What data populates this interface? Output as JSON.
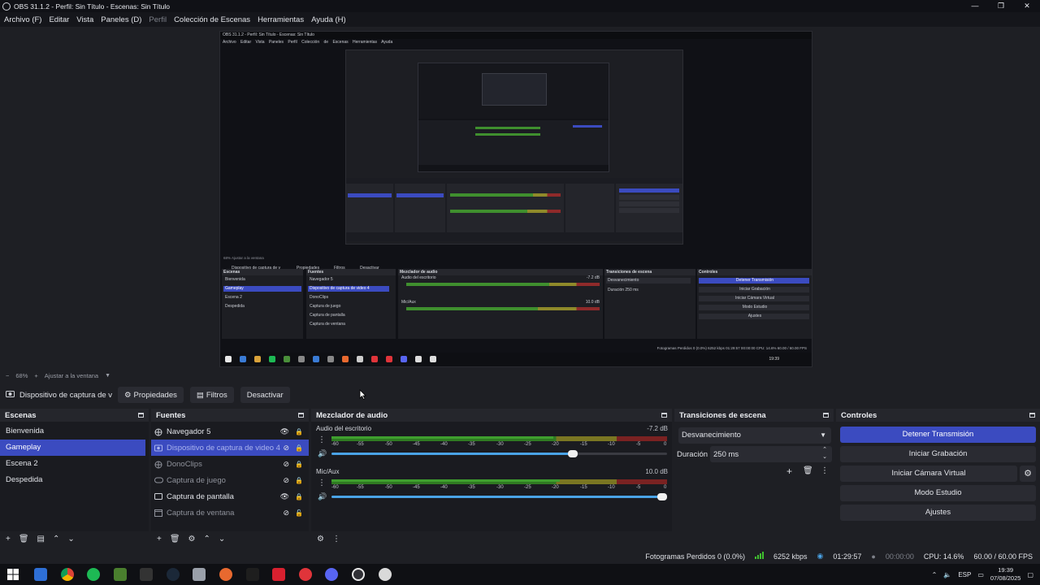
{
  "window": {
    "title": "OBS 31.1.2 - Perfil: Sin Título - Escenas: Sin Título",
    "min": "—",
    "max": "❐",
    "close": "✕"
  },
  "menu": {
    "archivo": "Archivo (F)",
    "editar": "Editar",
    "vista": "Vista",
    "paneles": "Paneles (D)",
    "perfil": "Perfil",
    "coleccion": "Colección de Escenas",
    "herramientas": "Herramientas",
    "ayuda": "Ayuda (H)"
  },
  "nested": {
    "title": "OBS 31.1.2 - Perfil: Sin Título - Escenas: Sin Título",
    "menu": "Archivo Editar Vista Paneles Perfil Colección de Escenas Herramientas Ayuda",
    "zoom": "68%   Ajustar a la ventana",
    "source": "Dispositivo de captura de v",
    "props": "Propiedades",
    "filters": "Filtros",
    "deactivate": "Desactivar",
    "scenes_title": "Escenas",
    "scenes": [
      "Bienvenida",
      "Gameplay",
      "Escena 2",
      "Despedida"
    ],
    "sources_title": "Fuentes",
    "sources": [
      "Navegador 5",
      "Dispositivo de captura de video 4",
      "DonoClips",
      "Captura de juego",
      "Captura de pantalla",
      "Captura de ventana"
    ],
    "mixer_title": "Mezclador de audio",
    "mixer_ch1": "Audio del escritorio",
    "mixer_ch1_db": "-7.2 dB",
    "mixer_ch2": "Mic/Aux",
    "mixer_ch2_db": "10.0 dB",
    "trans_title": "Transiciones de escena",
    "trans_value": "Desvanecimiento",
    "trans_duration": "Duración   250 ms",
    "ctrl_title": "Controles",
    "controls": [
      "Detener Transmisión",
      "Iniciar Grabación",
      "Iniciar Cámara Virtual",
      "Modo Estudio",
      "Ajustes"
    ],
    "status": "Fotogramas Perdidos 0 (0.0%)   6252 kbps   01:29:57   00:00:00   CPU: 14.6%   60.00 / 60.00 FPS",
    "clock": "19:39"
  },
  "zoom": {
    "level": "68%",
    "fit": "Ajustar a la ventana"
  },
  "source_bar": {
    "current": "Dispositivo de captura de v",
    "properties": "Propiedades",
    "filters": "Filtros",
    "deactivate": "Desactivar"
  },
  "scenes": {
    "title": "Escenas",
    "items": [
      "Bienvenida",
      "Gameplay",
      "Escena 2",
      "Despedida"
    ],
    "selected": 1
  },
  "sources": {
    "title": "Fuentes",
    "items": [
      {
        "name": "Navegador 5",
        "visible": true
      },
      {
        "name": "Dispositivo de captura de video 4",
        "visible": false
      },
      {
        "name": "DonoClips",
        "visible": false
      },
      {
        "name": "Captura de juego",
        "visible": false
      },
      {
        "name": "Captura de pantalla",
        "visible": true
      },
      {
        "name": "Captura de ventana",
        "visible": false
      }
    ],
    "selected": 1
  },
  "mixer": {
    "title": "Mezclador de audio",
    "ticks": [
      "-60",
      "-55",
      "-50",
      "-45",
      "-40",
      "-35",
      "-30",
      "-25",
      "-20",
      "-15",
      "-10",
      "-5",
      "0"
    ],
    "channels": [
      {
        "name": "Audio del escritorio",
        "db": "-7.2 dB",
        "volume": 0.72
      },
      {
        "name": "Mic/Aux",
        "db": "10.0 dB",
        "volume": 1.0
      }
    ]
  },
  "transitions": {
    "title": "Transiciones de escena",
    "value": "Desvanecimiento",
    "duration_label": "Duración",
    "duration_value": "250 ms"
  },
  "controls": {
    "title": "Controles",
    "stop_stream": "Detener Transmisión",
    "start_record": "Iniciar Grabación",
    "start_vcam": "Iniciar Cámara Virtual",
    "studio_mode": "Modo Estudio",
    "settings": "Ajustes"
  },
  "status": {
    "dropped": "Fotogramas Perdidos 0 (0.0%)",
    "bitrate": "6252 kbps",
    "stream_time": "01:29:57",
    "record_time": "00:00:00",
    "cpu": "CPU: 14.6%",
    "fps": "60.00 / 60.00 FPS"
  },
  "clock": {
    "time": "19:39",
    "date": "07/08/2025"
  },
  "tray": {
    "lang": "ESP"
  },
  "colors": {
    "accent": "#3b4bc0",
    "meter_green": "#3f8f2e",
    "meter_yellow": "#8f8a2a",
    "meter_red": "#8f2a2a"
  }
}
